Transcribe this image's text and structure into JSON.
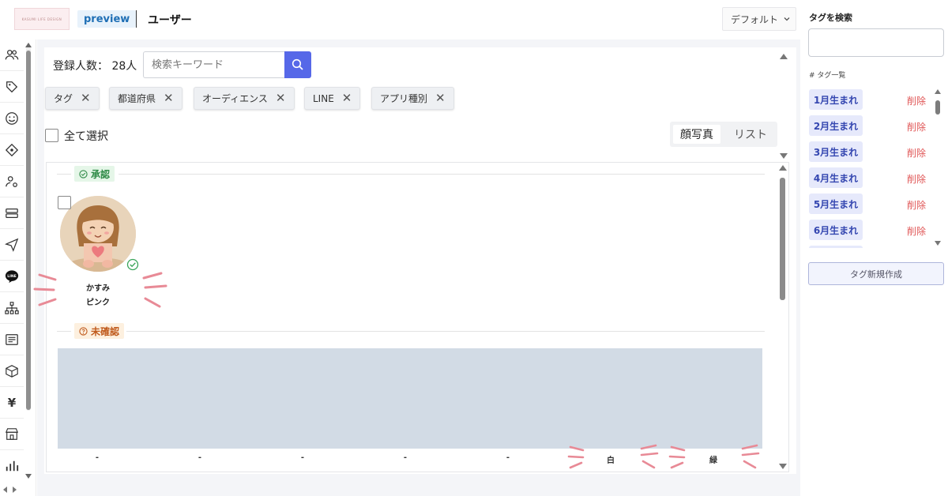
{
  "header": {
    "logo_text": "KASUMI LIFE DESIGN",
    "preview_label": "preview",
    "title": "ユーザー",
    "view_dropdown": "デフォルト"
  },
  "sidebar": {
    "icons": [
      "users-icon",
      "tag-icon",
      "smile-icon",
      "ticket-icon",
      "user-settings-icon",
      "layers-icon",
      "send-icon",
      "line-icon",
      "sitemap-icon",
      "message-icon",
      "box-icon",
      "yen-icon",
      "store-icon",
      "bar-chart-icon"
    ],
    "yen_glyph": "¥",
    "line_text": "LINE"
  },
  "toolbar": {
    "count_label": "登録人数： 28人",
    "search_placeholder": "検索キーワード"
  },
  "filters": [
    {
      "label": "タグ"
    },
    {
      "label": "都道府県"
    },
    {
      "label": "オーディエンス"
    },
    {
      "label": "LINE"
    },
    {
      "label": "アプリ種別"
    }
  ],
  "select_all_label": "全て選択",
  "view_toggle": {
    "photo": "顔写真",
    "list": "リスト",
    "active": "photo"
  },
  "sections": {
    "approved_label": "承認",
    "unconfirmed_label": "未確認"
  },
  "user": {
    "name": "かすみ",
    "color": "ピンク"
  },
  "bottom_labels": [
    "-",
    "-",
    "-",
    "-",
    "-",
    "白",
    "緑"
  ],
  "tag_panel": {
    "search_label": "タグを検索",
    "list_label": "# タグ一覧",
    "delete_label": "削除",
    "tags": [
      "1月生まれ",
      "2月生まれ",
      "3月生まれ",
      "4月生まれ",
      "5月生まれ",
      "6月生まれ"
    ],
    "create_button": "タグ新規作成"
  },
  "colors": {
    "accent": "#5668e8",
    "approved": "#2e8a46",
    "unconfirmed": "#c05a1c",
    "delete": "#e05656",
    "tag_chip_bg": "#e6e9fb",
    "placeholder": "#d2dbe5"
  }
}
